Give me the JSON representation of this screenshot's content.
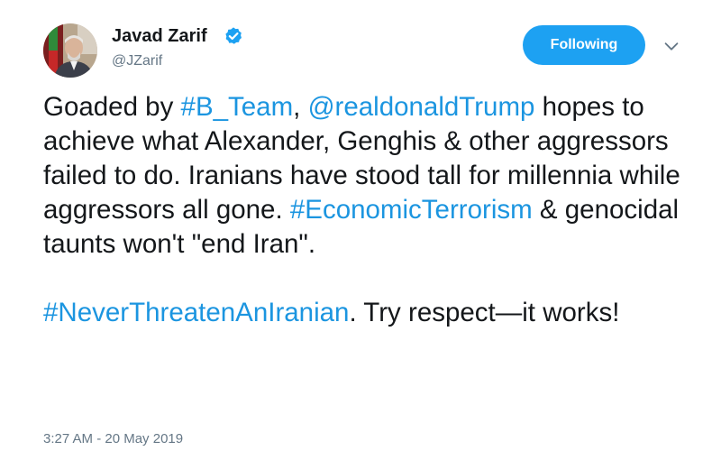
{
  "author": {
    "display_name": "Javad Zarif",
    "handle": "@JZarif",
    "verified": true
  },
  "actions": {
    "follow_label": "Following",
    "more_icon": "chevron-down-icon"
  },
  "tweet": {
    "p1": {
      "s1": "Goaded by ",
      "l1": "#B_Team",
      "s2": ", ",
      "l2": "@realdonaldTrump",
      "s3": " hopes to achieve what Alexander, Genghis & other aggressors failed to do. Iranians have stood tall for millennia while aggressors all gone. ",
      "l3": "#EconomicTerrorism",
      "s4": " & genocidal taunts won't \"end Iran\"."
    },
    "p2": {
      "l1": "#NeverThreatenAnIranian",
      "s1": ". Try respect—it works!"
    }
  },
  "meta": {
    "timestamp": "3:27 AM - 20 May 2019"
  },
  "colors": {
    "link": "#1b95e0",
    "button": "#1da1f2",
    "secondary_text": "#657786"
  }
}
